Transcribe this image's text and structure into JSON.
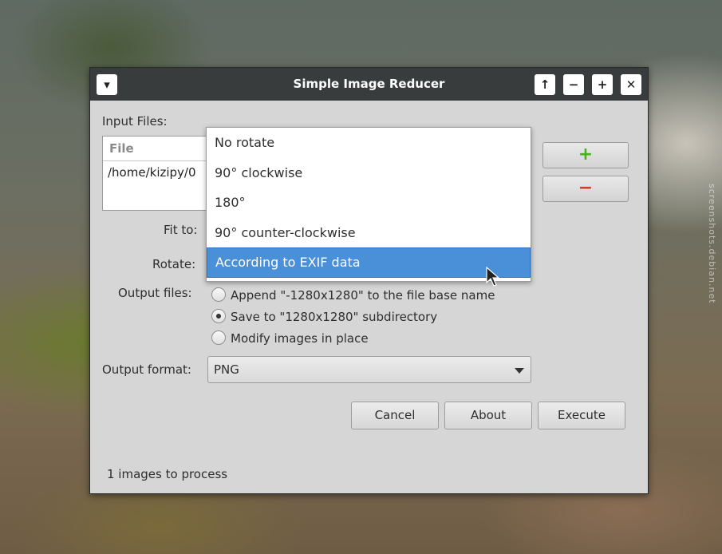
{
  "window": {
    "title": "Simple Image Reducer",
    "menu_icon": "chevron-down-icon",
    "controls": [
      "arrow-up-icon",
      "minimize-icon",
      "maximize-icon",
      "close-icon"
    ]
  },
  "input_files": {
    "label": "Input Files:",
    "column_header": "File",
    "rows": [
      "/home/kizipy/0"
    ],
    "add_icon": "plus-icon",
    "remove_icon": "minus-icon"
  },
  "fit_to": {
    "label": "Fit to:"
  },
  "rotate": {
    "label": "Rotate:",
    "options": [
      "No rotate",
      "90° clockwise",
      "180°",
      "90° counter-clockwise",
      "According to EXIF data"
    ],
    "selected_index": 4
  },
  "output_files": {
    "label": "Output files:",
    "options": [
      "Append \"-1280x1280\" to the file base name",
      "Save to \"1280x1280\" subdirectory",
      "Modify images in place"
    ],
    "selected_index": 1
  },
  "output_format": {
    "label": "Output format:",
    "value": "PNG"
  },
  "buttons": {
    "cancel": "Cancel",
    "about": "About",
    "execute": "Execute"
  },
  "status": "1 images to process",
  "watermark": "screenshots.debian.net",
  "colors": {
    "accent": "#4a90d9",
    "titlebar": "#383c3c",
    "add": "#4caf1f",
    "remove": "#d33a2a"
  }
}
